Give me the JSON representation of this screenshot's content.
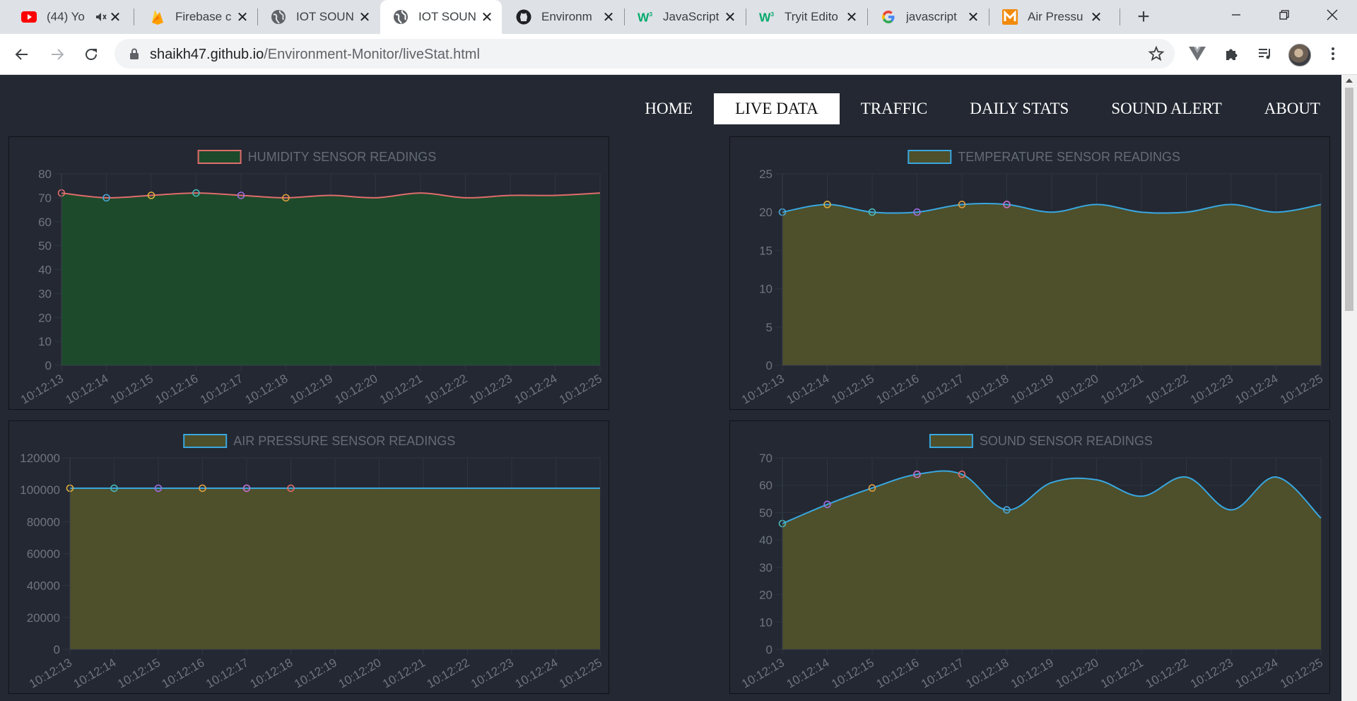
{
  "browser": {
    "tabs": [
      {
        "title": "(44) Yo",
        "icon": "youtube-icon",
        "active": false,
        "muted": true
      },
      {
        "title": "Firebase c",
        "icon": "firebase-icon",
        "active": false
      },
      {
        "title": "IOT SOUN",
        "icon": "globe-icon",
        "active": false
      },
      {
        "title": "IOT SOUN",
        "icon": "globe-icon",
        "active": true
      },
      {
        "title": "Environm",
        "icon": "github-icon",
        "active": false
      },
      {
        "title": "JavaScript",
        "icon": "w3schools-icon",
        "active": false
      },
      {
        "title": "Tryit Edito",
        "icon": "w3schools-icon",
        "active": false
      },
      {
        "title": "javascript",
        "icon": "google-icon",
        "active": false
      },
      {
        "title": "Air Pressu",
        "icon": "m-logo-icon",
        "active": false
      }
    ],
    "url_host": "shaikh47.github.io",
    "url_path": "/Environment-Monitor/liveStat.html"
  },
  "nav": {
    "items": [
      "HOME",
      "LIVE DATA",
      "TRAFFIC",
      "DAILY STATS",
      "SOUND ALERT",
      "ABOUT"
    ],
    "active": "LIVE DATA"
  },
  "colors": {
    "page_bg": "#232832",
    "humidity_fill": "#1d4a2b",
    "humidity_line": "#e06c6c",
    "olive_fill": "#4e4f2b",
    "blue_line": "#38a7e0",
    "point_colors": [
      "#e06c6c",
      "#4aa8d8",
      "#e0b03e",
      "#4ab8b8",
      "#a06ce0",
      "#e0a040",
      "#c870d0"
    ]
  },
  "chart_data": [
    {
      "type": "area",
      "title": "HUMIDITY SENSOR READINGS",
      "legend": "top",
      "grid": true,
      "categories": [
        "10:12:13",
        "10:12:14",
        "10:12:15",
        "10:12:16",
        "10:12:17",
        "10:12:18",
        "10:12:19",
        "10:12:20",
        "10:12:21",
        "10:12:22",
        "10:12:23",
        "10:12:24",
        "10:12:25"
      ],
      "series": [
        {
          "name": "HUMIDITY SENSOR READINGS",
          "values": [
            72,
            70,
            71,
            72,
            71,
            70,
            71,
            70,
            72,
            70,
            71,
            71,
            72
          ]
        }
      ],
      "ylim": [
        0,
        80
      ],
      "yticks": [
        0,
        10,
        20,
        30,
        40,
        50,
        60,
        70,
        80
      ],
      "points_shown": 6,
      "fill": "#1d4a2b",
      "line": "#e06c6c",
      "swatch_border": "#e06c6c"
    },
    {
      "type": "area",
      "title": "TEMPERATURE SENSOR READINGS",
      "legend": "top",
      "grid": true,
      "categories": [
        "10:12:13",
        "10:12:14",
        "10:12:15",
        "10:12:16",
        "10:12:17",
        "10:12:18",
        "10:12:19",
        "10:12:20",
        "10:12:21",
        "10:12:22",
        "10:12:23",
        "10:12:24",
        "10:12:25"
      ],
      "series": [
        {
          "name": "TEMPERATURE SENSOR READINGS",
          "values": [
            20,
            21,
            20,
            20,
            21,
            21,
            20,
            21,
            20,
            20,
            21,
            20,
            21
          ]
        }
      ],
      "ylim": [
        0,
        25
      ],
      "yticks": [
        0,
        5,
        10,
        15,
        20,
        25
      ],
      "points_shown": 6,
      "fill": "#4e4f2b",
      "line": "#38a7e0",
      "swatch_border": "#38a7e0"
    },
    {
      "type": "area",
      "title": "AIR PRESSURE SENSOR READINGS",
      "legend": "top",
      "grid": true,
      "categories": [
        "10:12:13",
        "10:12:14",
        "10:12:15",
        "10:12:16",
        "10:12:17",
        "10:12:18",
        "10:12:19",
        "10:12:20",
        "10:12:21",
        "10:12:22",
        "10:12:23",
        "10:12:24",
        "10:12:25"
      ],
      "series": [
        {
          "name": "AIR PRESSURE SENSOR READINGS",
          "values": [
            101000,
            101000,
            101000,
            101000,
            101000,
            101000,
            101000,
            101000,
            101000,
            101000,
            101000,
            101000,
            101000
          ]
        }
      ],
      "ylim": [
        0,
        120000
      ],
      "yticks": [
        0,
        20000,
        40000,
        60000,
        80000,
        100000,
        120000
      ],
      "points_shown": 6,
      "fill": "#4e4f2b",
      "line": "#38a7e0",
      "swatch_border": "#38a7e0"
    },
    {
      "type": "area",
      "title": "SOUND SENSOR READINGS",
      "legend": "top",
      "grid": true,
      "categories": [
        "10:12:13",
        "10:12:14",
        "10:12:15",
        "10:12:16",
        "10:12:17",
        "10:12:18",
        "10:12:19",
        "10:12:20",
        "10:12:21",
        "10:12:22",
        "10:12:23",
        "10:12:24",
        "10:12:25"
      ],
      "series": [
        {
          "name": "SOUND SENSOR READINGS",
          "values": [
            46,
            53,
            59,
            64,
            64,
            51,
            61,
            62,
            56,
            63,
            51,
            63,
            48
          ]
        }
      ],
      "ylim": [
        0,
        70
      ],
      "yticks": [
        0,
        10,
        20,
        30,
        40,
        50,
        60,
        70
      ],
      "points_shown": 6,
      "fill": "#4e4f2b",
      "line": "#38a7e0",
      "swatch_border": "#38a7e0"
    }
  ]
}
